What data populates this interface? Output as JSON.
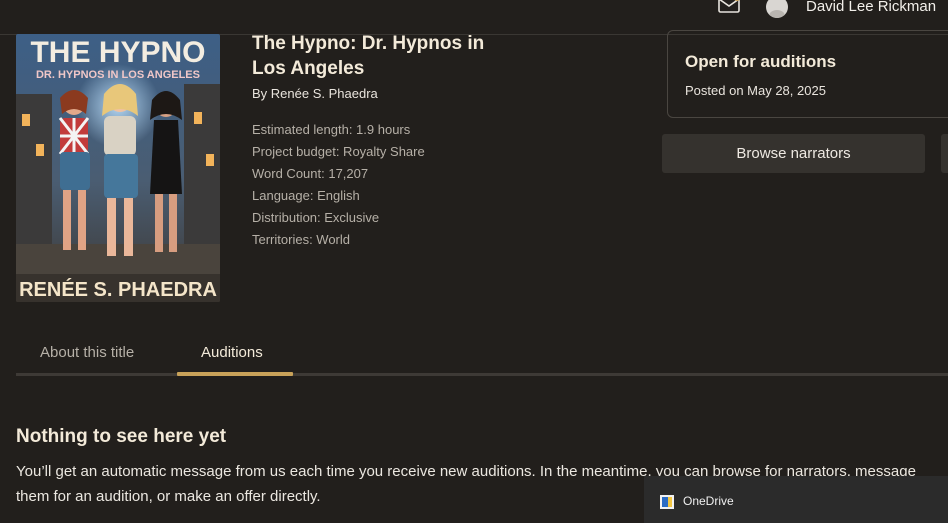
{
  "header": {
    "username": "David Lee Rickman"
  },
  "book": {
    "cover": {
      "title_line": "THE HYPNO",
      "subtitle_line": "DR. HYPNOS IN LOS ANGELES",
      "author_line": "RENÉE S. PHAEDRA"
    },
    "title": "The Hypno: Dr. Hypnos in Los Angeles",
    "author": "By Renée S. Phaedra",
    "facts": {
      "length": "Estimated length: 1.9 hours",
      "budget": "Project budget: Royalty Share",
      "word_count": "Word Count: 17,207",
      "language": "Language: English",
      "distribution": "Distribution: Exclusive",
      "territories": "Territories: World"
    }
  },
  "status": {
    "title": "Open for auditions",
    "posted": "Posted on May 28, 2025"
  },
  "actions": {
    "browse_label": "Browse narrators"
  },
  "tabs": {
    "about": "About this title",
    "auditions": "Auditions",
    "active": "Auditions"
  },
  "empty_state": {
    "title": "Nothing to see here yet",
    "text": "You’ll get an automatic message from us each time you receive new auditions. In the meantime, you can browse for narrators, message them for an audition, or make an offer directly."
  },
  "notification": {
    "label": "OneDrive"
  },
  "colors": {
    "background": "#221f1c",
    "accent": "#c9a259",
    "button": "#35322e"
  },
  "icons": [
    "mail-icon",
    "user-avatar-icon",
    "onedrive-icon"
  ]
}
